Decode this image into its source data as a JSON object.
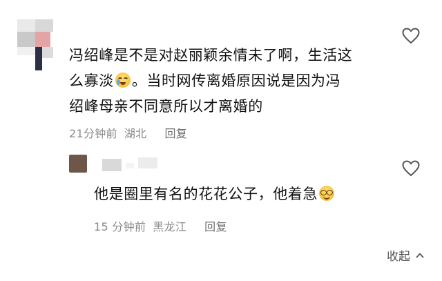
{
  "comment": {
    "text_line1": "冯绍峰是不是对赵丽颖余情未了啊，生活这",
    "text_line2_a": "么寡淡",
    "text_line2_b": "。当时网传离婚原因说是因为冯",
    "text_line3": "绍峰母亲不同意所以才离婚的",
    "emoji_name": "crying-laughing-emoji",
    "time": "21分钟前",
    "location": "湖北",
    "reply_label": "回复"
  },
  "reply": {
    "text": "他是圈里有名的花花公子，他着急",
    "emoji_name": "smirk-glasses-emoji",
    "time": "15 分钟前",
    "location": "黑龙江",
    "reply_label": "回复"
  },
  "footer": {
    "collapse_label": "收起"
  },
  "icons": {
    "like": "heart-outline-icon",
    "collapse": "chevron-up-icon"
  }
}
